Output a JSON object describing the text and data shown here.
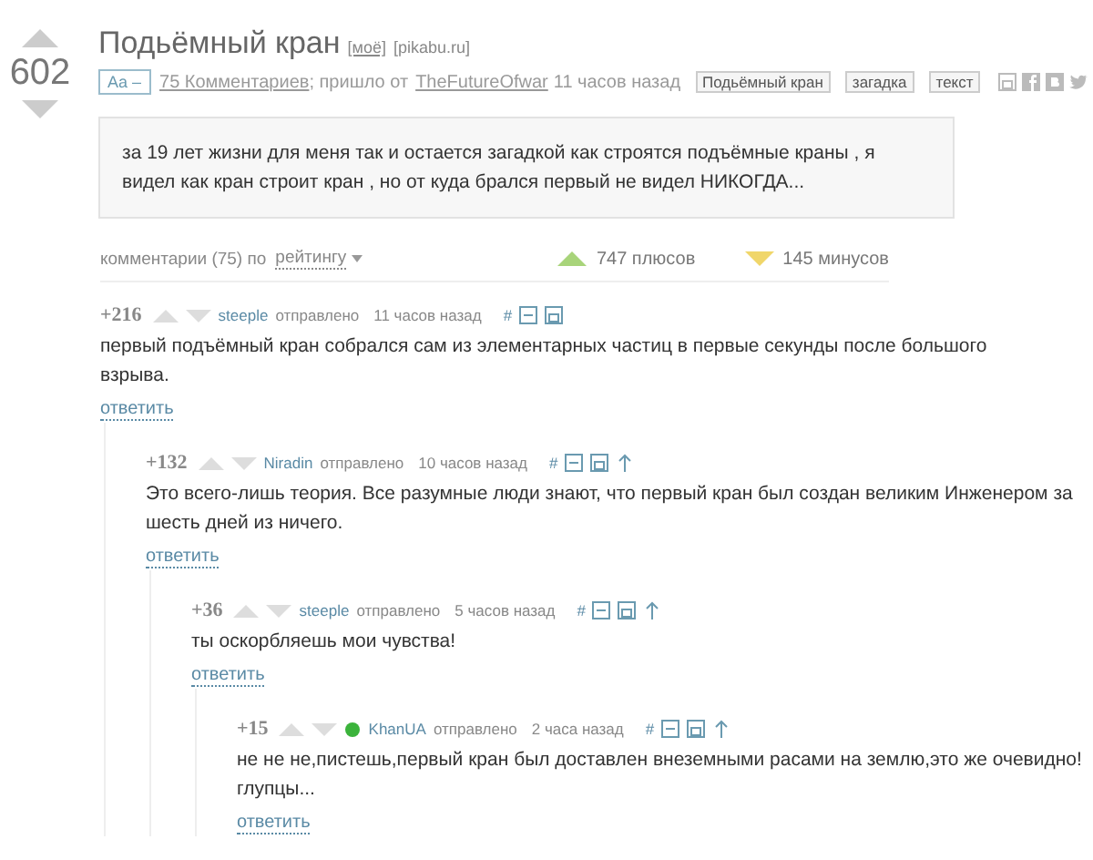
{
  "post": {
    "rating": "602",
    "title": "Подьёмный кран",
    "mine_link": "[моё]",
    "source": "[pikabu.ru]",
    "font_toggle": "Aa –",
    "comments_link": "75 Комментариев",
    "came_from": "; пришло от",
    "author": "TheFutureOfwar",
    "time": "11 часов назад",
    "tags": [
      "Подьёмный кран",
      "загадка",
      "текст"
    ],
    "body": "за 19 лет жизни для меня так и остается загадкой как строятся подъёмные краны , я видел как кран строит кран , но от куда брался первый не видел НИКОГДА..."
  },
  "comments_bar": {
    "label": "комментарии (75) по",
    "sort": "рейтингу",
    "plus": "747 плюсов",
    "minus": "145 минусов"
  },
  "comments": [
    {
      "score": "+216",
      "author": "steeple",
      "user_icon": false,
      "sent": "отправлено",
      "time": "11 часов назад",
      "hash": "#",
      "has_parent": false,
      "text": "первый подъёмный кран собрался сам из элементарных частиц в первые секунды после большого взрыва.",
      "reply": "ответить",
      "children": [
        {
          "score": "+132",
          "author": "Niradin",
          "user_icon": false,
          "sent": "отправлено",
          "time": "10 часов назад",
          "hash": "#",
          "has_parent": true,
          "text": "Это всего-лишь теория. Все разумные люди знают, что первый кран был создан великим Инженером за шесть дней из ничего.",
          "reply": "ответить",
          "children": [
            {
              "score": "+36",
              "author": "steeple",
              "user_icon": false,
              "sent": "отправлено",
              "time": "5 часов назад",
              "hash": "#",
              "has_parent": true,
              "text": "ты оскорбляешь мои чувства!",
              "reply": "ответить",
              "children": [
                {
                  "score": "+15",
                  "author": "KhanUA",
                  "user_icon": true,
                  "sent": "отправлено",
                  "time": "2 часа назад",
                  "hash": "#",
                  "has_parent": true,
                  "text": "не не не,пистешь,первый кран был доставлен внеземными расами на землю,это же очевидно!глупцы...",
                  "reply": "ответить"
                }
              ]
            }
          ]
        }
      ]
    }
  ]
}
